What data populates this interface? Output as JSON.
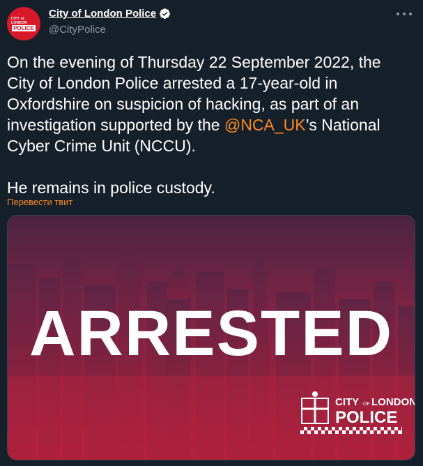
{
  "tweet": {
    "author_name": "City of London Police",
    "handle": "@CityPolice",
    "avatar_top_text": "CITY of LONDON",
    "avatar_police_text": "POLICE",
    "text_before_mention": "On the evening of Thursday 22 September 2022, the City of London Police arrested a 17-year-old in Oxfordshire on suspicion of hacking, as part of an investigation supported by the ",
    "mention": "@NCA_UK",
    "text_after_mention": "’s National Cyber Crime Unit (NCCU).",
    "paragraph_2": "He remains in police custody.",
    "translate_label": "Перевести твит"
  },
  "media": {
    "headline": "ARRESTED",
    "logo_line1": "CITY",
    "logo_of": "OF",
    "logo_line1b": "LONDON",
    "logo_line2": "POLICE"
  },
  "colors": {
    "accent": "#ff8a1f",
    "background": "#15202b",
    "brand_red": "#d7192a",
    "secondary_text": "#8b98a5"
  },
  "icons": [
    "verified-badge-icon",
    "more-options-icon",
    "crest-icon"
  ]
}
